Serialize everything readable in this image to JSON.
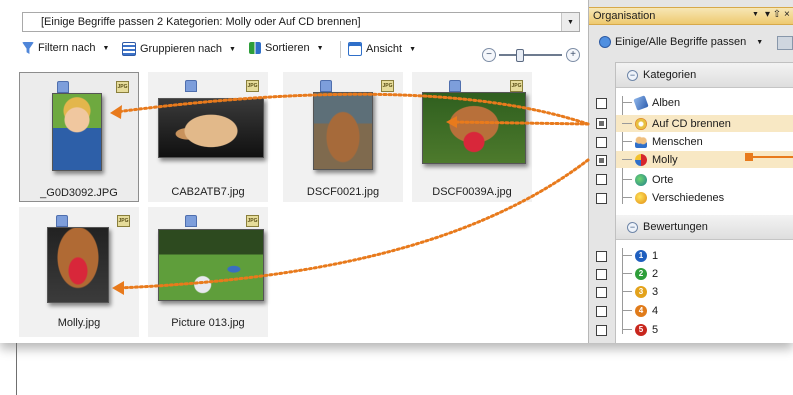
{
  "browser": {
    "filter_text": "[Einige Begriffe passen 2 Kategorien: Molly oder Auf CD brennen]",
    "toolbar": {
      "filter": "Filtern nach",
      "group": "Gruppieren nach",
      "sort": "Sortieren",
      "view": "Ansicht"
    },
    "zoom": {
      "minus": "−",
      "plus": "+"
    },
    "file_type": "JPG",
    "thumbnails": [
      {
        "name": "_G0D3092.JPG",
        "selected": true
      },
      {
        "name": "CAB2ATB7.jpg",
        "selected": false
      },
      {
        "name": "DSCF0021.jpg",
        "selected": false
      },
      {
        "name": "DSCF0039A.jpg",
        "selected": false
      },
      {
        "name": "Molly.jpg",
        "selected": false
      },
      {
        "name": "Picture 013.jpg",
        "selected": false
      }
    ]
  },
  "organizer": {
    "title": "Organisation",
    "pin": "▾ ⇧ ×",
    "match_label": "Einige/Alle Begriffe passen",
    "categories_header": "Kategorien",
    "categories": [
      {
        "label": "Alben",
        "icon": "album-icon",
        "checked": false
      },
      {
        "label": "Auf CD brennen",
        "icon": "burn-cd-icon",
        "checked": true,
        "highlight": true
      },
      {
        "label": "Menschen",
        "icon": "people-icon",
        "checked": false
      },
      {
        "label": "Molly",
        "icon": "molly-category-icon",
        "checked": true,
        "highlight": true
      },
      {
        "label": "Orte",
        "icon": "places-icon",
        "checked": false
      },
      {
        "label": "Verschiedenes",
        "icon": "misc-icon",
        "checked": false
      }
    ],
    "ratings_header": "Bewertungen",
    "ratings": [
      {
        "label": "1",
        "color": "#1f5fbf"
      },
      {
        "label": "2",
        "color": "#2e9e3a"
      },
      {
        "label": "3",
        "color": "#e3a21b"
      },
      {
        "label": "4",
        "color": "#e07b1a"
      },
      {
        "label": "5",
        "color": "#c8261d"
      }
    ]
  },
  "colors": {
    "accent": "#e87a1c",
    "highlight": "#f8e8c4"
  }
}
